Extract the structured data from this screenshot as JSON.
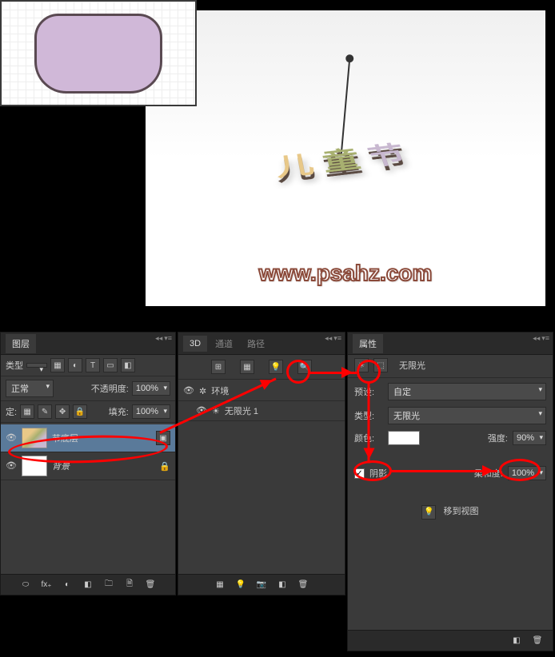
{
  "canvas": {
    "watermark": "www.psahz.com",
    "text_chars": [
      "儿",
      "童",
      "节"
    ]
  },
  "layers_panel": {
    "tab": "图层",
    "type_label": "类型",
    "blend_mode": "正常",
    "opacity_label": "不透明度:",
    "opacity_value": "100%",
    "lock_label": "定:",
    "fill_label": "填充:",
    "fill_value": "100%",
    "rows": [
      {
        "name": "节底层",
        "active": true
      },
      {
        "name": "背景",
        "active": false
      }
    ],
    "footer_icons": [
      "⬭",
      "fx₊",
      "◐",
      "◧",
      "🗀",
      "🗎",
      "🗑"
    ]
  },
  "three_d_panel": {
    "tabs": [
      "3D",
      "通道",
      "路径"
    ],
    "header_icons": [
      "⊞",
      "▦",
      "💡",
      "🔍"
    ],
    "rows": [
      {
        "icon": "✲",
        "name": "环境"
      },
      {
        "icon": "☀",
        "name": "无限光 1"
      }
    ],
    "footer_icons": [
      "▦",
      "💡",
      "📷",
      "◧",
      "🗑"
    ]
  },
  "properties_panel": {
    "tab": "属性",
    "header_icon": "☀",
    "header_sub_icon": "⬚",
    "light_type_title": "无限光",
    "preset_label": "预设:",
    "preset_value": "自定",
    "type_label": "类型:",
    "type_value": "无限光",
    "color_label": "颜色:",
    "intensity_label": "强度:",
    "intensity_value": "90%",
    "shadow_label": "阴影",
    "shadow_checked": "✓",
    "softness_label": "柔和度:",
    "softness_value": "100%",
    "move_to_view": "移到视图",
    "footer_icons": [
      "◧",
      "🗑"
    ]
  }
}
